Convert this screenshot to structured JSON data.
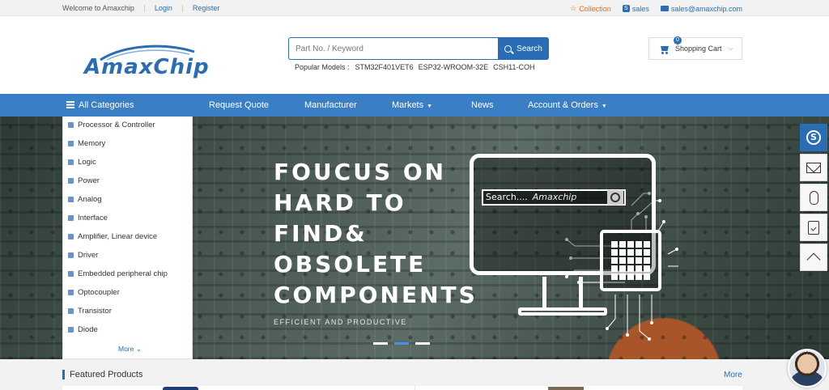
{
  "topbar": {
    "welcome": "Welcome to Amaxchip",
    "login": "Login",
    "register": "Register",
    "collection": "Collection",
    "skype": "sales",
    "email": "sales@amaxchip.com"
  },
  "logo": {
    "text": "AmaxChip"
  },
  "search": {
    "placeholder": "Part No. / Keyword",
    "button": "Search",
    "popular_label": "Popular Models :",
    "popular": [
      "STM32F401VET6",
      "ESP32-WROOM-32E",
      "CSH11-COH"
    ]
  },
  "cart": {
    "label": "Shopping Cart",
    "count": "0"
  },
  "nav": {
    "all_categories": "All Categories",
    "request_quote": "Request Quote",
    "manufacturer": "Manufacturer",
    "markets": "Markets",
    "news": "News",
    "account": "Account & Orders"
  },
  "categories": {
    "items": [
      "Processor & Controller",
      "Memory",
      "Logic",
      "Power",
      "Analog",
      "Interface",
      "Amplifier, Linear device",
      "Driver",
      "Embedded peripheral chip",
      "Optocoupler",
      "Transistor",
      "Diode"
    ],
    "more": "More"
  },
  "banner": {
    "lines": [
      "FOUCUS ON",
      "HARD TO",
      "FIND&",
      "OBSOLETE",
      "COMPONENTS"
    ],
    "tagline": "EFFICIENT AND PRODUCTIVE",
    "search_text": "Search....",
    "search_brand": "Amaxchip",
    "slides": 3,
    "active_slide": 2
  },
  "featured": {
    "title": "Featured Products",
    "more": "More"
  },
  "colors": {
    "brand": "#2a6db5",
    "nav": "#3a7fc6",
    "collection": "#f06a1d"
  },
  "tools": {
    "icons": [
      "skype-icon",
      "mail-icon",
      "footprint-icon",
      "clipboard-icon",
      "back-to-top-icon"
    ]
  }
}
